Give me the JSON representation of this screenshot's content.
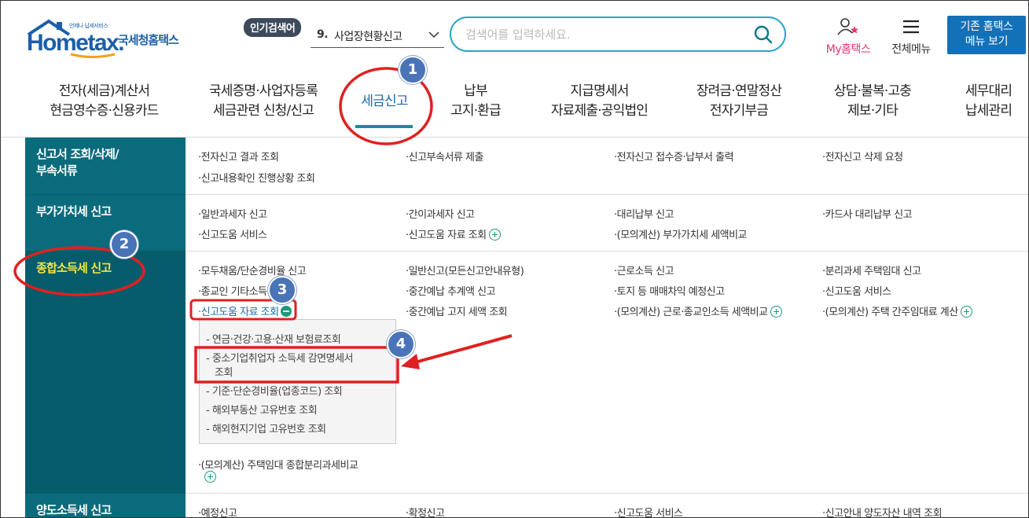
{
  "header": {
    "logo_small": "언제나 납세서비스",
    "logo_main": "Hometax.",
    "logo_kr": "국세청홈택스",
    "popular_badge": "인기검색어",
    "popular_num": "9.",
    "popular_text": "사업장현황신고",
    "search_placeholder": "검색어를 입력하세요.",
    "my_hometax": "My홈택스",
    "all_menu": "전체메뉴",
    "old_home_line1": "기존 홈택스",
    "old_home_line2": "메뉴 보기"
  },
  "gnb": [
    {
      "line1": "전자(세금)계산서",
      "line2": "현금영수증·신용카드"
    },
    {
      "line1": "국세증명·사업자등록",
      "line2": "세금관련 신청/신고"
    },
    {
      "line1": "세금신고",
      "line2": ""
    },
    {
      "line1": "납부",
      "line2": "고지·환급"
    },
    {
      "line1": "지급명세서",
      "line2": "자료제출·공익법인"
    },
    {
      "line1": "장려금·연말정산",
      "line2": "전자기부금"
    },
    {
      "line1": "상담·불복·고충",
      "line2": "제보·기타"
    },
    {
      "line1": "세무대리",
      "line2": "납세관리"
    }
  ],
  "categories": [
    {
      "line1": "신고서 조회/삭제/",
      "line2": "부속서류"
    },
    {
      "line1": "부가가치세 신고",
      "line2": ""
    },
    {
      "line1": "종합소득세 신고",
      "line2": ""
    },
    {
      "line1": "양도소득세 신고",
      "line2": ""
    }
  ],
  "rows": {
    "r1": [
      "·전자신고 결과 조회",
      "·신고부속서류 제출",
      "·전자신고 접수증·납부서 출력",
      "·전자신고 삭제 요청",
      "·신고내용확인 진행상황 조회"
    ],
    "r2": [
      "·일반과세자 신고",
      "·간이과세자 신고",
      "·대리납부 신고",
      "·카드사 대리납부 신고",
      "·신고도움 서비스",
      "·신고도움 자료 조회",
      "·(모의계산) 부가가치세 세액비교"
    ],
    "r3": [
      "·모두채움/단순경비율 신고",
      "·일반신고(모든신고안내유형)",
      "·근로소득 신고",
      "·분리과세 주택임대 신고",
      "·종교인 기타소득 신고",
      "·중간예납 추계액 신고",
      "·토지 등 매매차익 예정신고",
      "·신고도움 서비스",
      "·신고도움 자료 조회",
      "·중간예납 고지 세액 조회",
      "·(모의계산) 근로·종교인소득 세액비교",
      "·(모의계산) 주택 간주임대료 계산",
      "·(모의계산) 주택임대 종합분리과세비교"
    ],
    "r4": [
      "·예정신고",
      "·확정신고",
      "·신고도움 서비스",
      "·신고안내 양도자산 내역 조회"
    ]
  },
  "submenu": [
    "- 연금·건강·고용·산재 보험료조회",
    "- 중소기업취업자 소득세 감면명세서",
    "조회",
    "- 기준·단순경비율(업종코드) 조회",
    "- 해외부동산 고유번호 조회",
    "- 해외현지기업 고유번호 조회"
  ],
  "badges": [
    "1",
    "2",
    "3",
    "4"
  ],
  "colors": {
    "accent": "#1b8aa0",
    "category_bg": "#0a6b7c",
    "selected_text": "#f5e63f",
    "annotation": "#e02020",
    "badge": "#4a74b8"
  }
}
